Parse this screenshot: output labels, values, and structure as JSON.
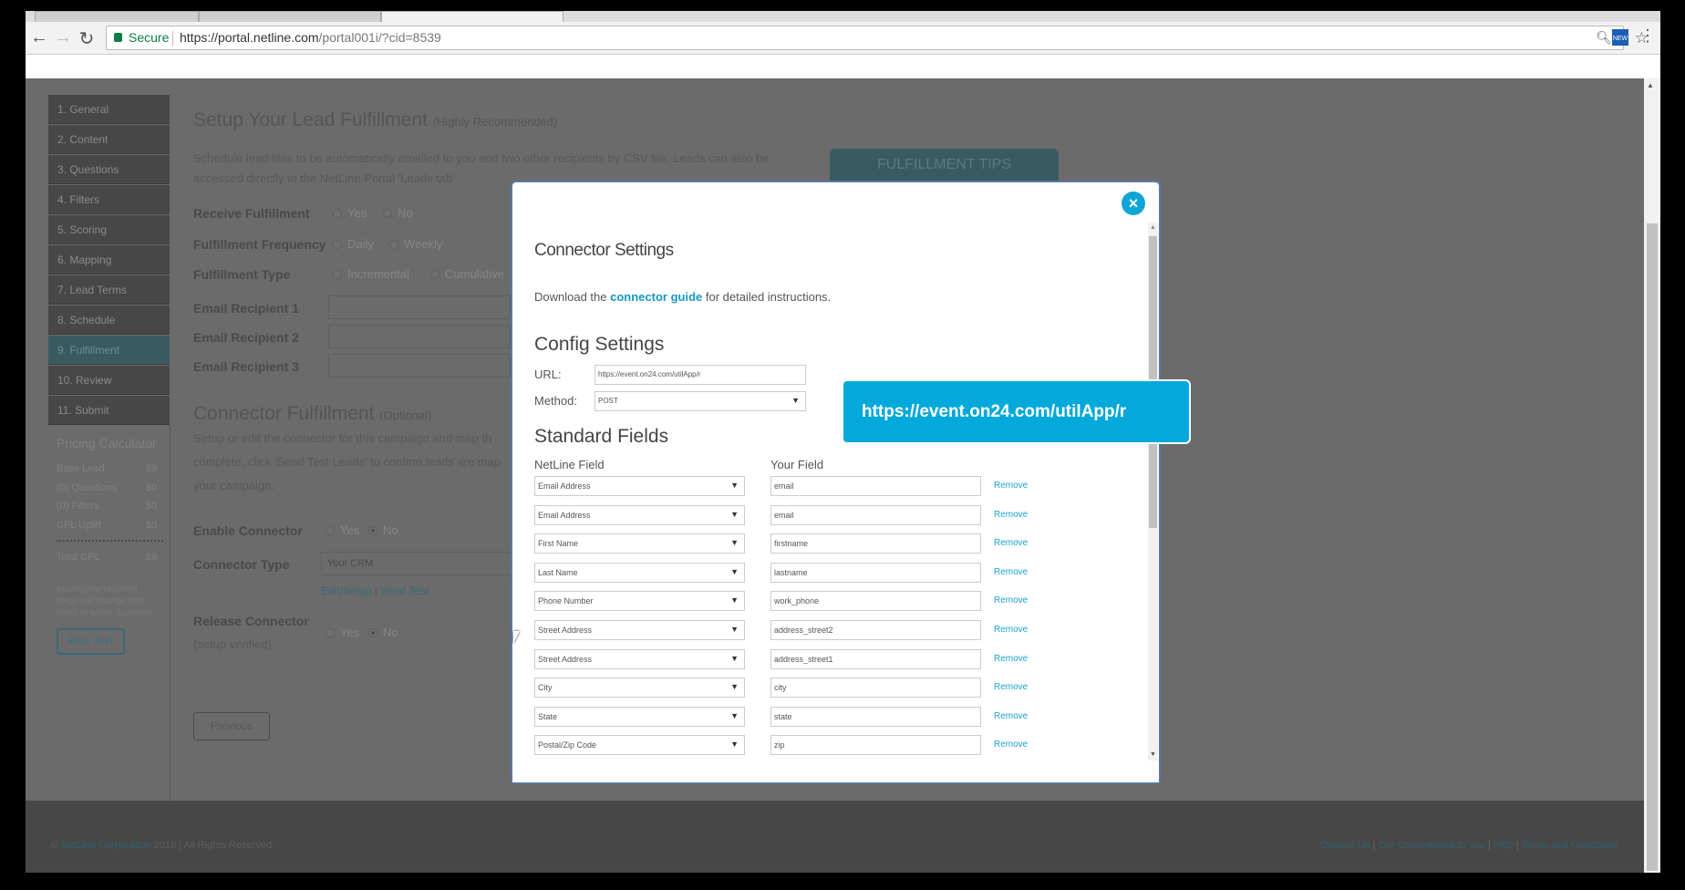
{
  "browser": {
    "secure_label": "Secure",
    "url_host": "https://portal.netline.com",
    "url_path": "/portal001i/?cid=8539"
  },
  "sidebar": {
    "items": [
      "1. General",
      "2. Content",
      "3. Questions",
      "4. Filters",
      "5. Scoring",
      "6. Mapping",
      "7. Lead Terms",
      "8. Schedule",
      "9. Fulfillment",
      "10. Review",
      "11. Submit"
    ],
    "active_index": 8
  },
  "pricing": {
    "title": "Pricing Calculator",
    "rows": [
      [
        "Base Lead",
        "$9"
      ],
      [
        "(0) Questions",
        "$0"
      ],
      [
        "(0) Filters",
        "$0"
      ],
      [
        "CPL Uplift",
        "$0"
      ]
    ],
    "total": [
      "Total CPL",
      "$9"
    ],
    "note": "Incomplete required steps will change from black to white. Example:",
    "example_button": "Blue Text"
  },
  "main": {
    "title": "Setup Your Lead Fulfillment",
    "title_suffix": "(Highly Recommended)",
    "desc": "Schedule lead files to be automatically emailed to you and two other recipients by CSV file. Leads can also be accessed directly in the NetLine Portal 'Leads tab'.",
    "tips_button": "FULFILLMENT TIPS",
    "receive": {
      "label": "Receive Fulfillment",
      "options": [
        "Yes",
        "No"
      ]
    },
    "frequency": {
      "label": "Fulfillment Frequency",
      "options": [
        "Daily",
        "Weekly"
      ]
    },
    "type": {
      "label": "Fulfillment Type",
      "options": [
        "Incremental",
        "Cumulative"
      ]
    },
    "recipients": [
      "Email Recipient 1",
      "Email Recipient 2",
      "Email Recipient 3"
    ],
    "connector_title": "Connector Fulfillment",
    "connector_suffix": "(Optional)",
    "connector_desc1": "Setup or edit the connector for this campaign and map th",
    "connector_desc2": "complete, click 'Send Test Leads' to confirm leads are map",
    "connector_desc3": "your campaign.",
    "enable": {
      "label": "Enable Connector",
      "options": [
        "Yes",
        "No"
      ],
      "selected": "No"
    },
    "connector_type": {
      "label": "Connector Type",
      "value": "Your CRM"
    },
    "edit_setup": "Edit/Setup",
    "send_test": "Send Test",
    "release": {
      "label": "Release Connector",
      "sublabel": "(setup verified)",
      "options": [
        "Yes",
        "No"
      ],
      "selected": "No"
    },
    "previous_button": "Previous"
  },
  "modal": {
    "title": "Connector Settings",
    "download_pre": "Download the ",
    "download_link": "connector guide",
    "download_post": " for detailed instructions.",
    "config_title": "Config Settings",
    "url_label": "URL:",
    "url_value": "https://event.on24.com/utilApp/r",
    "method_label": "Method:",
    "method_value": "POST",
    "standard_title": "Standard Fields",
    "col_netline": "NetLine Field",
    "col_yours": "Your Field",
    "remove_label": "Remove",
    "rows": [
      [
        "Email Address",
        "email"
      ],
      [
        "Email Address",
        "email"
      ],
      [
        "First Name",
        "firstname"
      ],
      [
        "Last Name",
        "lastname"
      ],
      [
        "Phone Number",
        "work_phone"
      ],
      [
        "Street Address",
        "address_street2"
      ],
      [
        "Street Address",
        "address_street1"
      ],
      [
        "City",
        "city"
      ],
      [
        "State",
        "state"
      ],
      [
        "Postal/Zip Code",
        "zip"
      ]
    ]
  },
  "tooltip": "https://event.on24.com/utilApp/r",
  "footer": {
    "copyright_symbol": "©",
    "company": "NetLine Corporation",
    "rights": " 2018 | All Rights Reserved.",
    "links": [
      "Contact Us",
      "Our Commitment to You",
      "FAQ",
      "Terms and Conditions"
    ]
  },
  "colors": {
    "accent": "#03a9db",
    "overlay": "#6b6b6b",
    "footer": "#474747"
  }
}
